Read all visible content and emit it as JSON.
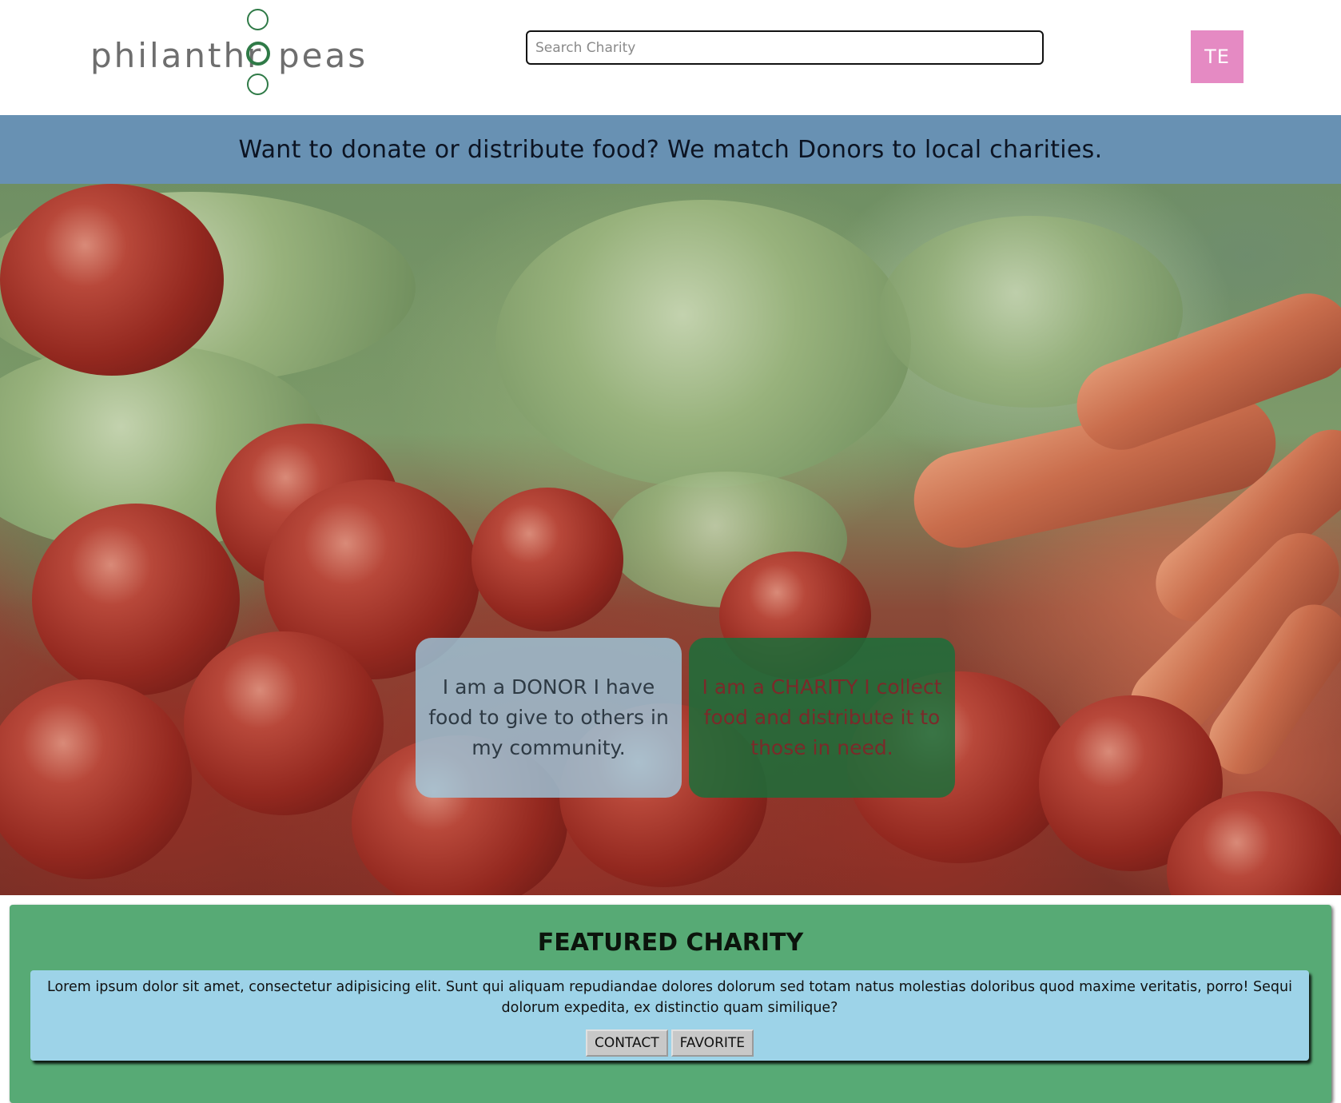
{
  "header": {
    "logo": {
      "text_left": "philanthr",
      "text_right": "peas",
      "mark_color": "#2f7a47"
    },
    "search": {
      "placeholder": "Search Charity",
      "value": ""
    },
    "avatar": {
      "initials": "TE",
      "color": "#e58ac3"
    }
  },
  "banner": {
    "text": "Want to donate or distribute food? We match Donors to local charities.",
    "color": "#6891b3"
  },
  "hero": {
    "donor_card": {
      "text": "I am a DONOR I have food to give to others in my community."
    },
    "charity_card": {
      "text": "I am a CHARITY I collect food and distribute it to those in need."
    }
  },
  "featured": {
    "title": "FEATURED CHARITY",
    "description": "Lorem ipsum dolor sit amet, consectetur adipisicing elit. Sunt qui aliquam repudiandae dolores dolorum sed totam natus molestias doloribus quod maxime veritatis, porro! Sequi dolorum expedita, ex distinctio quam similique?",
    "contact_label": "CONTACT",
    "favorite_label": "FAVORITE",
    "color": "#57aa75",
    "card_color": "#9dd3e8"
  }
}
